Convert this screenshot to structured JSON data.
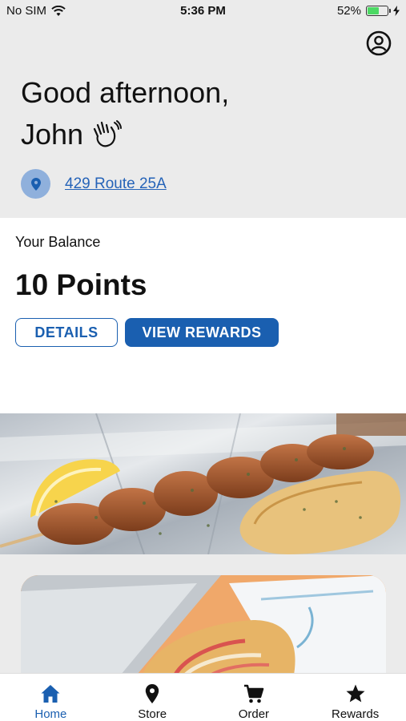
{
  "status_bar": {
    "carrier": "No SIM",
    "time": "5:36 PM",
    "battery_percent": "52%",
    "battery_level": 0.52
  },
  "header": {
    "greeting_line1": "Good afternoon,",
    "greeting_line2": "John",
    "address": "429 Route 25A"
  },
  "balance": {
    "label": "Your Balance",
    "points": "10 Points",
    "details_label": "DETAILS",
    "rewards_label": "VIEW REWARDS"
  },
  "tabs": [
    {
      "label": "Home",
      "icon": "home-icon",
      "active": true
    },
    {
      "label": "Store",
      "icon": "location-pin-icon",
      "active": false
    },
    {
      "label": "Order",
      "icon": "cart-icon",
      "active": false
    },
    {
      "label": "Rewards",
      "icon": "star-icon",
      "active": false
    }
  ],
  "colors": {
    "accent": "#1a5fb0",
    "header_bg": "#ebebeb",
    "link": "#2563b8",
    "battery": "#4cd964"
  }
}
